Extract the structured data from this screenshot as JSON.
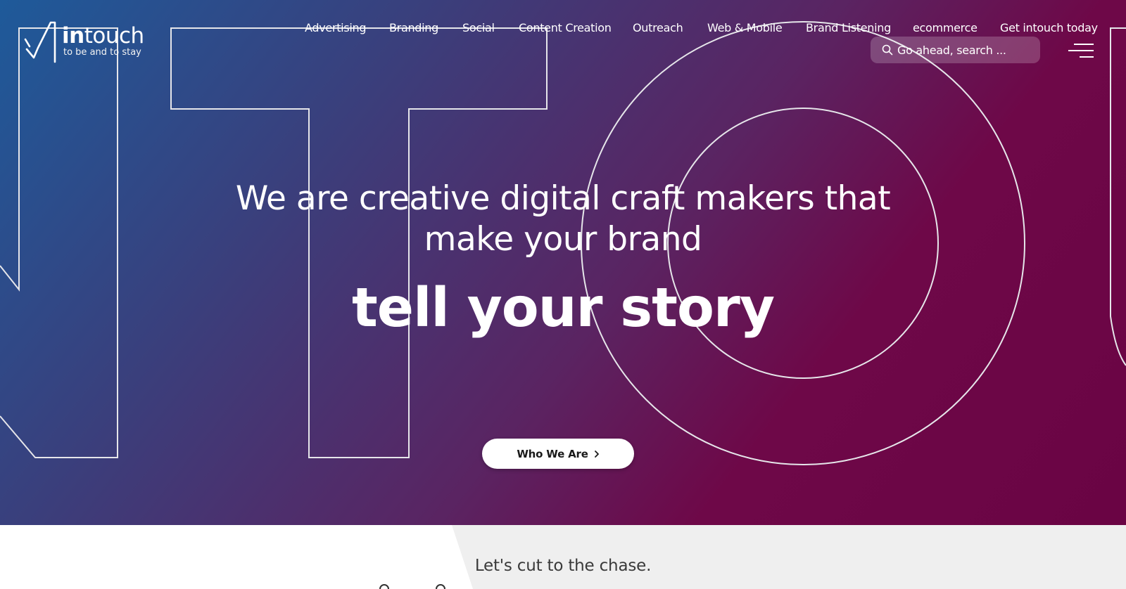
{
  "brand": {
    "name_bold": "in",
    "name_light": "touch",
    "tagline": "to be and to stay"
  },
  "nav": {
    "items": [
      {
        "label": "Advertising"
      },
      {
        "label": "Branding"
      },
      {
        "label": "Social"
      },
      {
        "label": "Content Creation"
      },
      {
        "label": "Outreach"
      },
      {
        "label": "Web & Mobile"
      },
      {
        "label": "Brand Listening"
      },
      {
        "label": "ecommerce"
      },
      {
        "label": "Get intouch today"
      }
    ]
  },
  "search": {
    "placeholder": "Go ahead, search ...",
    "icon": "search-icon"
  },
  "menu": {
    "icon": "hamburger-menu-icon"
  },
  "hero": {
    "headline_line1": "We are creative digital craft makers that",
    "headline_line2": "make your brand",
    "tagline": "tell your story",
    "cta_label": "Who We Are",
    "cta_icon": "chevron-right-icon",
    "gradient_colors": [
      "#1e5a9a",
      "#3a3f7c",
      "#5a2462",
      "#6e0848"
    ]
  },
  "section": {
    "title": "Let's cut to the chase."
  },
  "colors": {
    "accent": "#6e0848",
    "panel": "#efefef"
  }
}
